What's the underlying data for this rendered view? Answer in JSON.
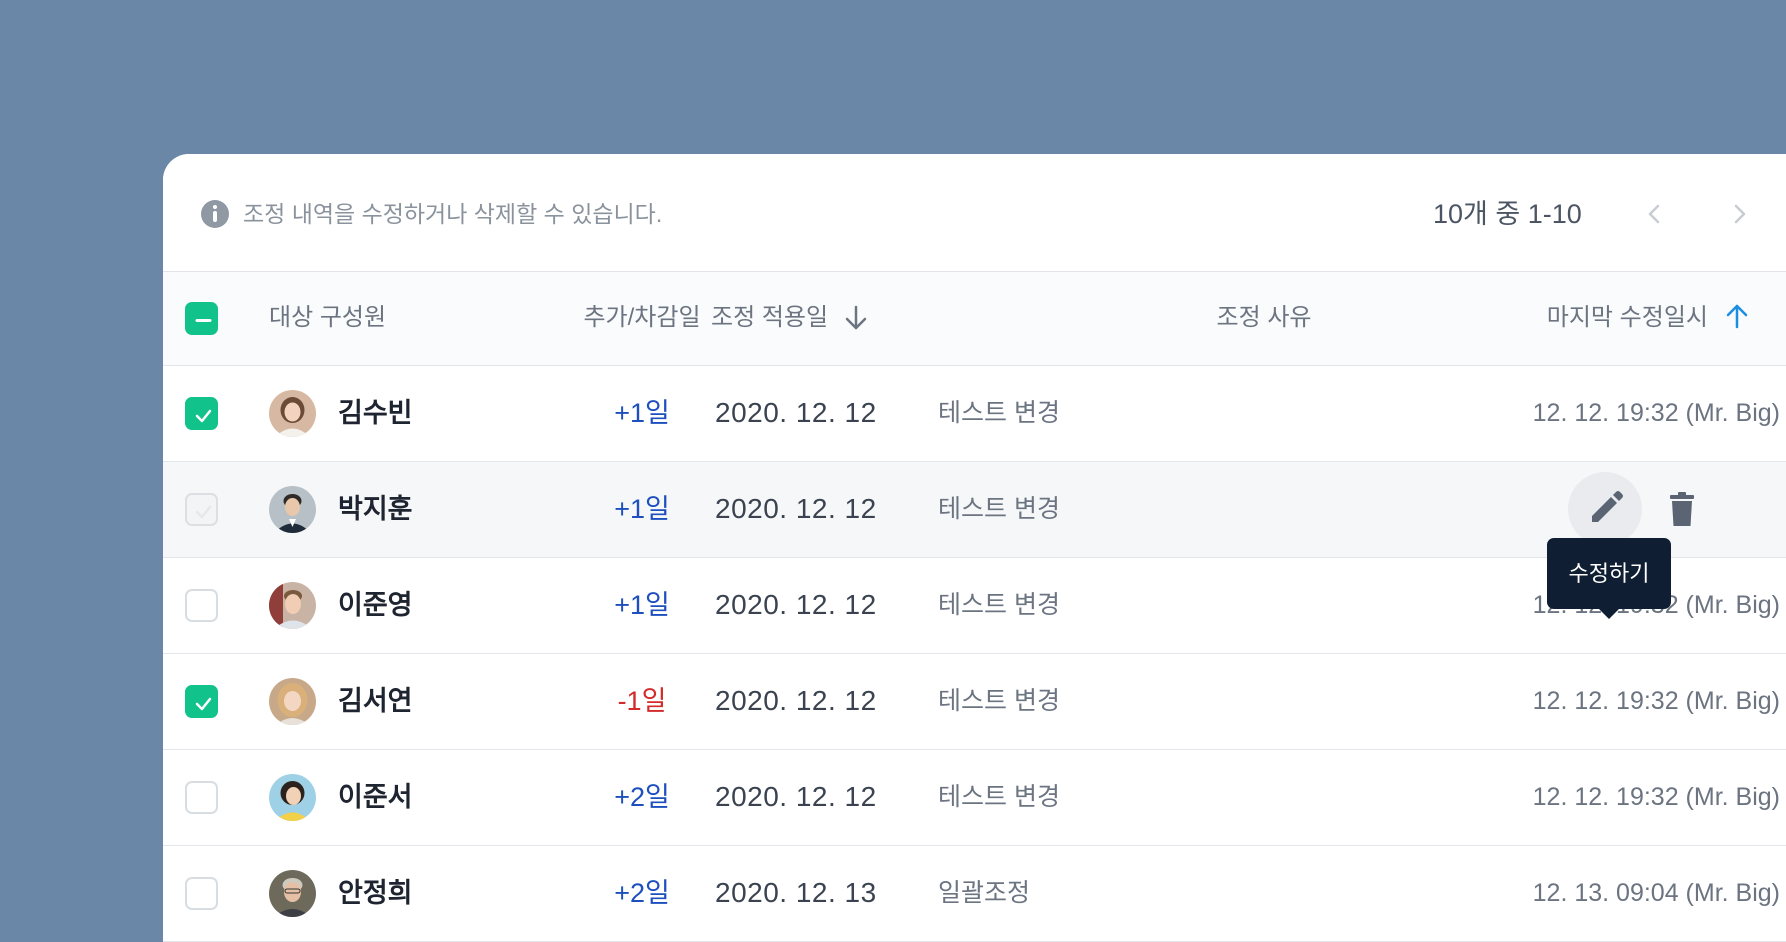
{
  "info": {
    "text": "조정 내역을 수정하거나 삭제할 수 있습니다.",
    "icon": "info-icon"
  },
  "pagination": {
    "text": "10개 중 1-10",
    "prev_icon": "chevron-left-icon",
    "next_icon": "chevron-right-icon"
  },
  "table": {
    "headers": {
      "member": "대상 구성원",
      "days": "추가/차감일",
      "date": "조정 적용일",
      "reason": "조정 사유",
      "modified": "마지막 수정일시"
    },
    "sort": {
      "date": "descending",
      "modified": "ascending"
    },
    "select_all_state": "indeterminate",
    "rows": [
      {
        "name": "김수빈",
        "days": "+1일",
        "date": "2020. 12. 12",
        "reason": "테스트 변경",
        "modified": "12. 12. 19:32 (Mr. Big)",
        "checked": true
      },
      {
        "name": "박지훈",
        "days": "+1일",
        "date": "2020. 12. 12",
        "reason": "테스트 변경",
        "modified": "",
        "checked": false,
        "disabled": true
      },
      {
        "name": "이준영",
        "days": "+1일",
        "date": "2020. 12. 12",
        "reason": "테스트 변경",
        "modified": "12. 12. 19:32 (Mr. Big)",
        "checked": false
      },
      {
        "name": "김서연",
        "days": "-1일",
        "date": "2020. 12. 12",
        "reason": "테스트 변경",
        "modified": "12. 12. 19:32 (Mr. Big)",
        "checked": true
      },
      {
        "name": "이준서",
        "days": "+2일",
        "date": "2020. 12. 12",
        "reason": "테스트 변경",
        "modified": "12. 12. 19:32 (Mr. Big)",
        "checked": false
      },
      {
        "name": "안정희",
        "days": "+2일",
        "date": "2020. 12. 13",
        "reason": "일괄조정",
        "modified": "12. 13. 09:04 (Mr. Big)",
        "checked": false
      }
    ]
  },
  "actions": {
    "tooltip": "수정하기",
    "edit_icon": "pencil-icon",
    "delete_icon": "trash-icon"
  },
  "colors": {
    "accent_green": "#12c28b",
    "positive_days": "#1d4fbf",
    "negative_days": "#d42a2a",
    "sort_active": "#1a8fe0",
    "tooltip_bg": "#0f1e33",
    "page_bg": "#6b87a7"
  }
}
